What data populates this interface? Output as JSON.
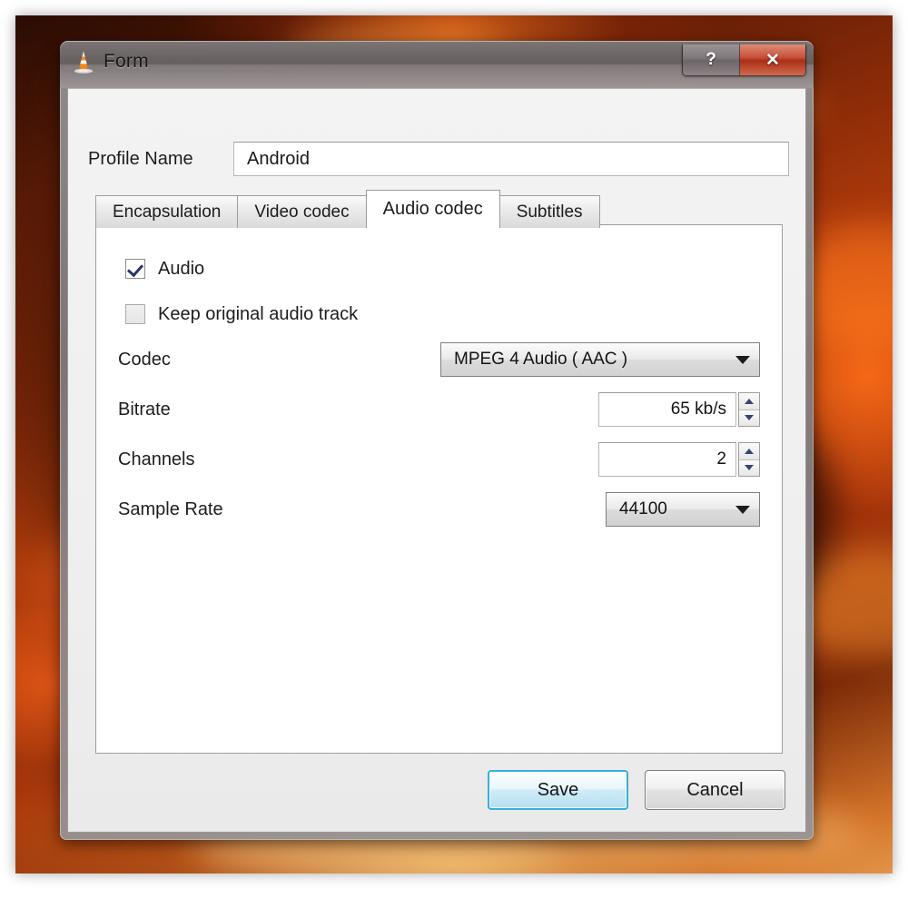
{
  "window": {
    "title": "Form",
    "app_icon": "vlc-cone-icon",
    "help_label": "?",
    "close_label": "✕",
    "accent_close_color": "#ab2e18",
    "accent_default_button_color": "#38b0d8"
  },
  "profile": {
    "label": "Profile Name",
    "value": "Android",
    "placeholder": ""
  },
  "tabs": [
    {
      "label": "Encapsulation",
      "active": false
    },
    {
      "label": "Video codec",
      "active": false
    },
    {
      "label": "Audio codec",
      "active": true
    },
    {
      "label": "Subtitles",
      "active": false
    }
  ],
  "audio_panel": {
    "audio_checkbox": {
      "label": "Audio",
      "checked": true
    },
    "keep_original_checkbox": {
      "label": "Keep original audio track",
      "checked": false
    },
    "codec": {
      "label": "Codec",
      "value": "MPEG 4 Audio ( AAC )",
      "icon": "chevron-down-icon"
    },
    "bitrate": {
      "label": "Bitrate",
      "value": "65 kb/s",
      "spinner_up_icon": "caret-up-icon",
      "spinner_down_icon": "caret-down-icon"
    },
    "channels": {
      "label": "Channels",
      "value": "2",
      "spinner_up_icon": "caret-up-icon",
      "spinner_down_icon": "caret-down-icon"
    },
    "sample_rate": {
      "label": "Sample Rate",
      "value": "44100",
      "icon": "chevron-down-icon"
    }
  },
  "footer": {
    "save_label": "Save",
    "cancel_label": "Cancel"
  }
}
